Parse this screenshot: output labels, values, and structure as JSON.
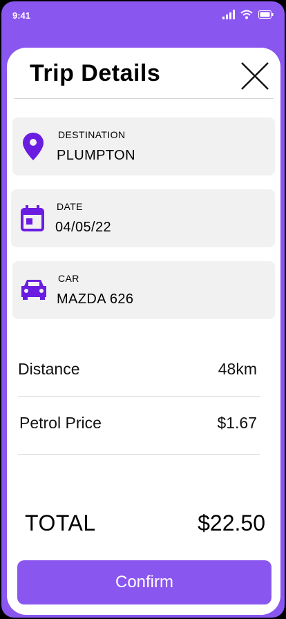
{
  "status_bar": {
    "time": "9:41"
  },
  "header": {
    "title": "Trip Details"
  },
  "destination": {
    "label": "DESTINATION",
    "value": "PLUMPTON"
  },
  "date": {
    "label": "DATE",
    "value": "04/05/22"
  },
  "car": {
    "label": "CAR",
    "value": "MAZDA 626"
  },
  "summary": [
    {
      "label": "Distance",
      "value": "48km"
    },
    {
      "label": "Petrol Price",
      "value": "$1.67"
    }
  ],
  "total": {
    "label": "TOTAL",
    "value": "$22.50"
  },
  "actions": {
    "confirm_label": "Confirm"
  },
  "colors": {
    "accent": "#8a56f0",
    "icon": "#6a1de0",
    "card_bg": "#f1f1f1"
  }
}
